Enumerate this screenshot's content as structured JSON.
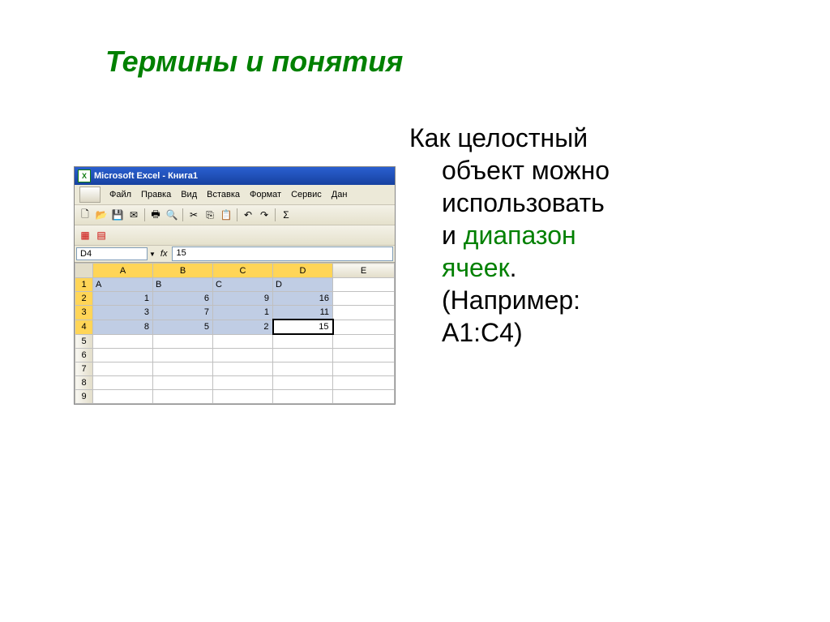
{
  "title": "Термины и понятия",
  "body": {
    "line1": "Как целостный",
    "line2": "объект можно",
    "line3": "использовать",
    "line4a": "и ",
    "line4b": "диапазон",
    "line5": "ячеек",
    "line5dot": ".",
    "line6": "(Например:",
    "line7": "А1:С4)"
  },
  "excel": {
    "app_title": "Microsoft Excel - Книга1",
    "menu": [
      "Файл",
      "Правка",
      "Вид",
      "Вставка",
      "Формат",
      "Сервис",
      "Дан"
    ],
    "namebox": "D4",
    "formula": "15",
    "fx_label": "fx",
    "columns": [
      "A",
      "B",
      "C",
      "D",
      "E"
    ],
    "rows": [
      "1",
      "2",
      "3",
      "4",
      "5",
      "6",
      "7",
      "8",
      "9"
    ],
    "cells": {
      "A1": "A",
      "B1": "B",
      "C1": "C",
      "D1": "D",
      "A2": "1",
      "B2": "6",
      "C2": "9",
      "D2": "16",
      "A3": "3",
      "B3": "7",
      "C3": "1",
      "D3": "11",
      "A4": "8",
      "B4": "5",
      "C4": "2",
      "D4": "15"
    },
    "icons": {
      "new": "🗋",
      "open": "📂",
      "save": "💾",
      "mail": "✉",
      "print": "🖶",
      "preview": "🔍",
      "spell": "✓",
      "cut": "✂",
      "copy": "⎘",
      "paste": "📋",
      "undo": "↶",
      "redo": "↷",
      "sum": "Σ",
      "pdf": "▦",
      "chart": "▤"
    }
  }
}
